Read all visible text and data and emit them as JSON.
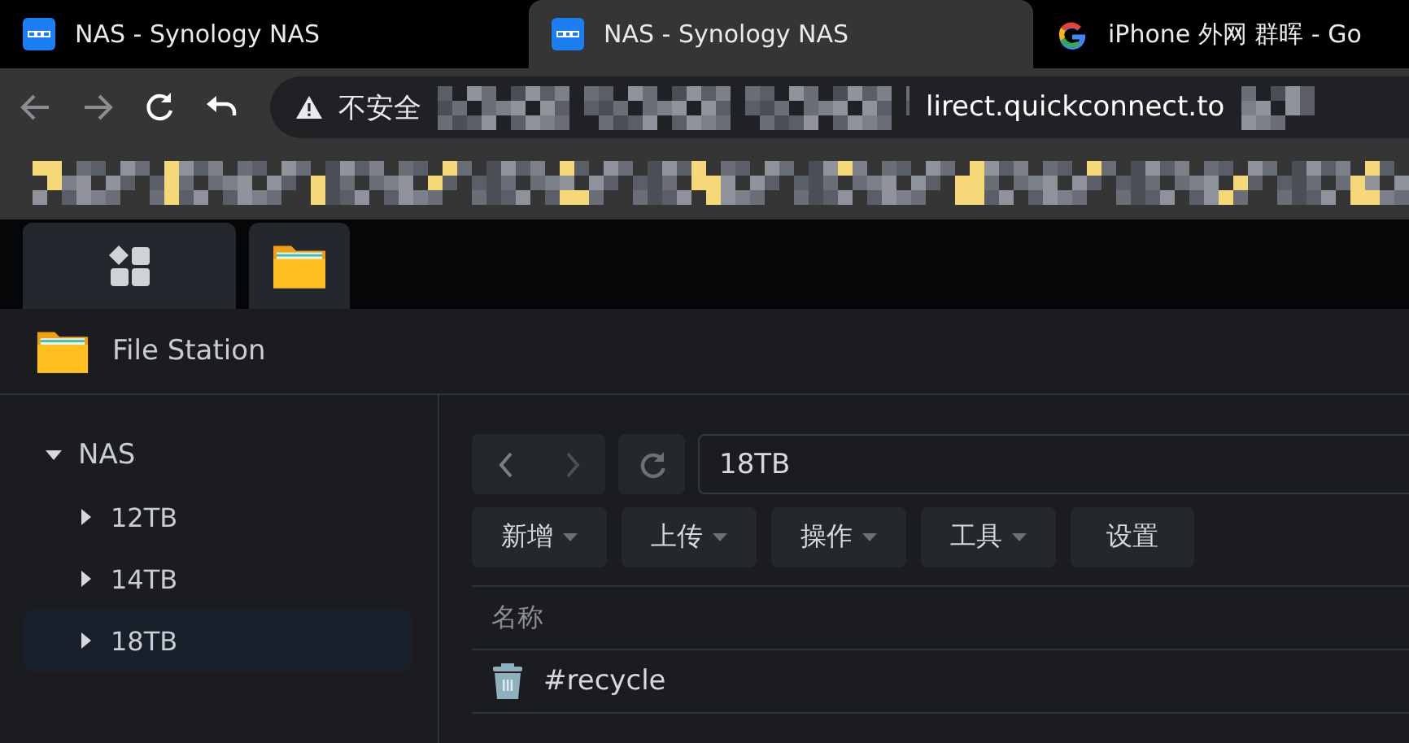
{
  "browser": {
    "tabs": [
      {
        "title": "NAS - Synology NAS",
        "kind": "dsm",
        "selected": false
      },
      {
        "title": "NAS - Synology NAS",
        "kind": "dsm",
        "selected": true
      },
      {
        "title": "iPhone 外网 群晖 - Go",
        "kind": "google",
        "selected": false
      }
    ],
    "security_label": "不安全",
    "url": "lirect.quickconnect.to"
  },
  "app": {
    "title": "File Station",
    "tree": [
      {
        "label": "NAS",
        "expanded": true,
        "selected": false,
        "children": [
          {
            "label": "12TB",
            "expanded": false,
            "selected": false
          },
          {
            "label": "14TB",
            "expanded": false,
            "selected": false
          },
          {
            "label": "18TB",
            "expanded": false,
            "selected": true
          }
        ]
      }
    ],
    "path": "18TB",
    "toolbar": [
      {
        "label": "新增",
        "dropdown": true
      },
      {
        "label": "上传",
        "dropdown": true
      },
      {
        "label": "操作",
        "dropdown": true
      },
      {
        "label": "工具",
        "dropdown": true
      },
      {
        "label": "设置",
        "dropdown": false
      }
    ],
    "columns": [
      "名称"
    ],
    "rows": [
      {
        "name": "#recycle",
        "kind": "recycle"
      }
    ]
  }
}
